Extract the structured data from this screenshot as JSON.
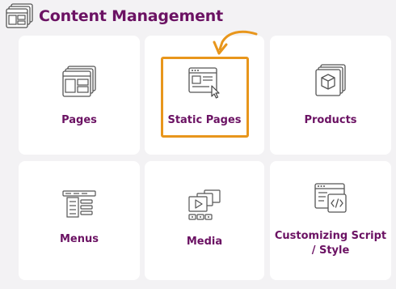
{
  "header": {
    "title": "Content Management",
    "icon": "content-management-icon"
  },
  "colors": {
    "title": "#6b1263",
    "highlight": "#e8961c",
    "card_bg": "#ffffff",
    "page_bg": "#f3f2f4"
  },
  "cards": [
    {
      "label": "Pages",
      "icon": "pages-icon",
      "highlighted": false
    },
    {
      "label": "Static Pages",
      "icon": "static-pages-icon",
      "highlighted": true
    },
    {
      "label": "Products",
      "icon": "products-icon",
      "highlighted": false
    },
    {
      "label": "Menus",
      "icon": "menus-icon",
      "highlighted": false
    },
    {
      "label": "Media",
      "icon": "media-icon",
      "highlighted": false
    },
    {
      "label": "Customizing Script / Style",
      "icon": "code-icon",
      "highlighted": false
    }
  ]
}
